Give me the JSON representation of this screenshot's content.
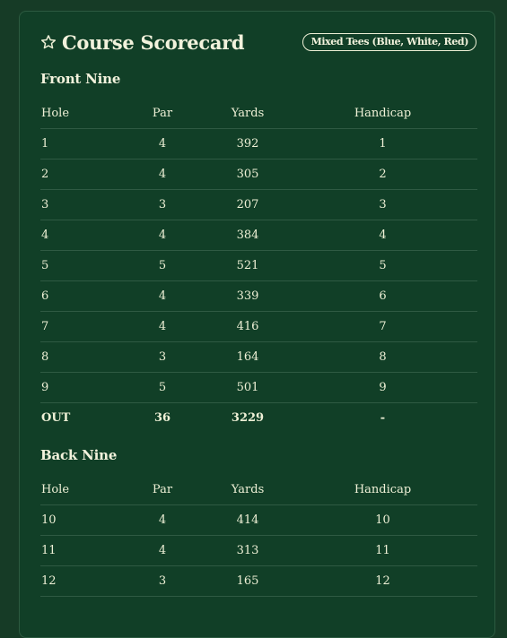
{
  "header": {
    "title": "Course Scorecard",
    "tees_badge": "Mixed Tees (Blue, White, Red)",
    "icon": "star-icon"
  },
  "columns": {
    "hole": "Hole",
    "par": "Par",
    "yards": "Yards",
    "handicap": "Handicap"
  },
  "front_nine": {
    "title": "Front Nine",
    "rows": [
      {
        "hole": "1",
        "par": "4",
        "yards": "392",
        "handicap": "1"
      },
      {
        "hole": "2",
        "par": "4",
        "yards": "305",
        "handicap": "2"
      },
      {
        "hole": "3",
        "par": "3",
        "yards": "207",
        "handicap": "3"
      },
      {
        "hole": "4",
        "par": "4",
        "yards": "384",
        "handicap": "4"
      },
      {
        "hole": "5",
        "par": "5",
        "yards": "521",
        "handicap": "5"
      },
      {
        "hole": "6",
        "par": "4",
        "yards": "339",
        "handicap": "6"
      },
      {
        "hole": "7",
        "par": "4",
        "yards": "416",
        "handicap": "7"
      },
      {
        "hole": "8",
        "par": "3",
        "yards": "164",
        "handicap": "8"
      },
      {
        "hole": "9",
        "par": "5",
        "yards": "501",
        "handicap": "9"
      }
    ],
    "total": {
      "hole": "OUT",
      "par": "36",
      "yards": "3229",
      "handicap": "-"
    }
  },
  "back_nine": {
    "title": "Back Nine",
    "rows": [
      {
        "hole": "10",
        "par": "4",
        "yards": "414",
        "handicap": "10"
      },
      {
        "hole": "11",
        "par": "4",
        "yards": "313",
        "handicap": "11"
      },
      {
        "hole": "12",
        "par": "3",
        "yards": "165",
        "handicap": "12"
      }
    ]
  },
  "colors": {
    "background": "#113f27",
    "text": "#eef0d6",
    "divider": "#2f5a43"
  }
}
